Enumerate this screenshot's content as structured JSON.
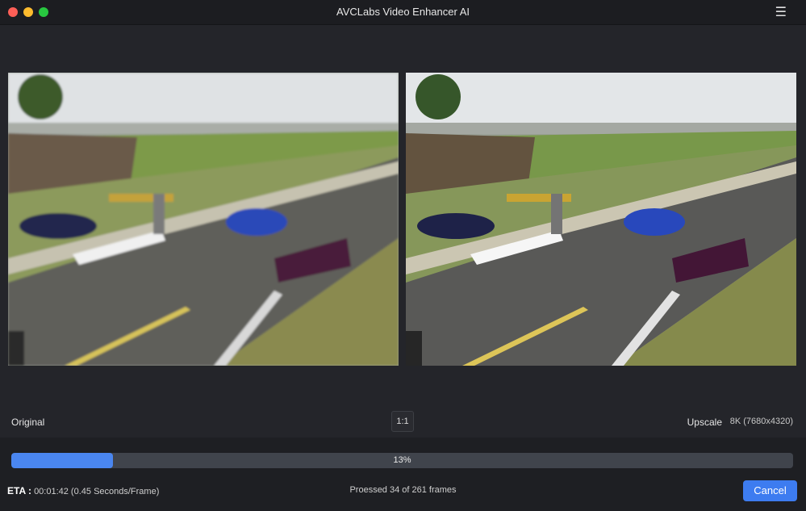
{
  "window": {
    "title": "AVCLabs Video Enhancer AI"
  },
  "icons": {
    "menu": "hamburger-menu-icon"
  },
  "preview": {
    "original_label": "Original",
    "zoom_label": "1:1",
    "upscale_label": "Upscale",
    "resolution": "8K (7680x4320)"
  },
  "progress": {
    "percent": 13,
    "percent_text": "13%",
    "eta_label": "ETA :",
    "eta_value": "00:01:42 (0.45 Seconds/Frame)",
    "processed_text": "Proessed 34 of 261 frames",
    "cancel_label": "Cancel"
  },
  "colors": {
    "accent": "#3d7cf0",
    "progress_fill": "#4a86f0",
    "background": "#24252a"
  }
}
